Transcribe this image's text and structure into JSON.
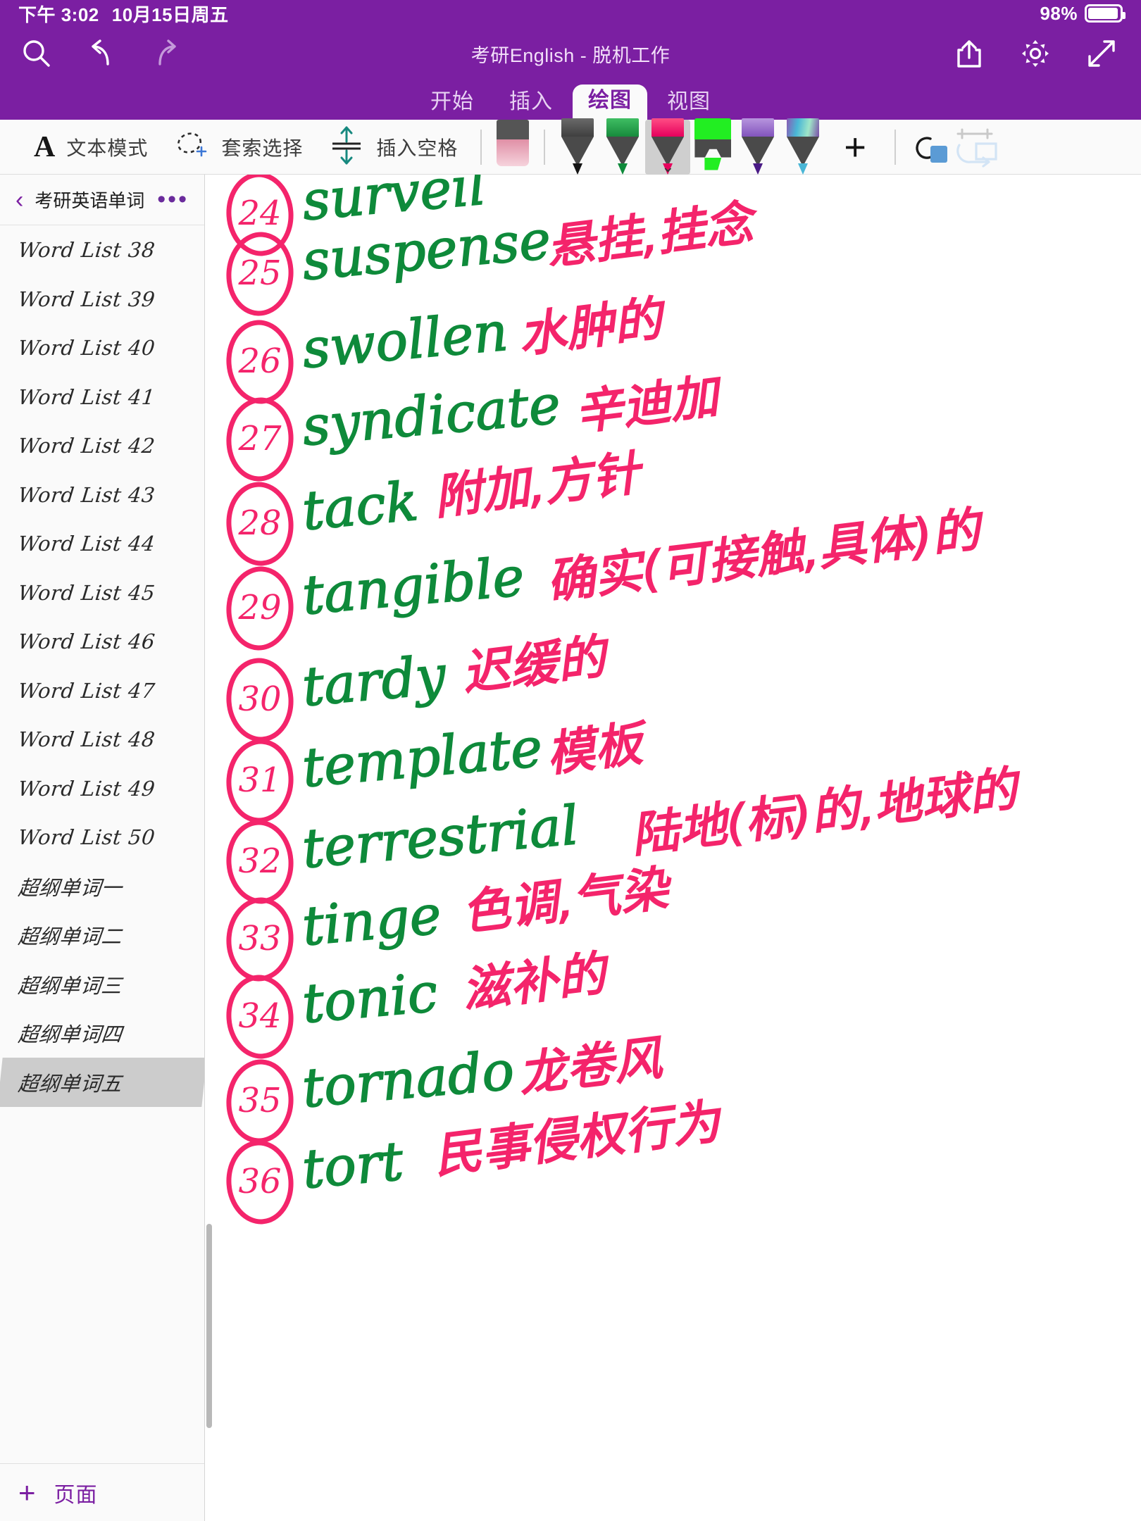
{
  "statusbar": {
    "time": "下午 3:02",
    "date": "10月15日周五",
    "battery_percent": "98%"
  },
  "header": {
    "doc_title": "考研English - 脱机工作",
    "icons": {
      "search": "search-icon",
      "undo": "undo-icon",
      "redo": "redo-icon",
      "share": "share-icon",
      "settings": "gear-icon",
      "expand": "expand-icon"
    },
    "tabs": [
      {
        "label": "开始",
        "active": false
      },
      {
        "label": "插入",
        "active": false
      },
      {
        "label": "绘图",
        "active": true
      },
      {
        "label": "视图",
        "active": false
      }
    ]
  },
  "toolbar": {
    "text_mode_glyph": "A",
    "text_mode_label": "文本模式",
    "lasso_label": "套索选择",
    "insert_space_label": "插入空格",
    "add_pen_glyph": "+",
    "pens": [
      {
        "name": "eraser",
        "cap": "#E79BAE",
        "body": "#4a4a4a",
        "tip": "#F2C2CE",
        "type": "eraser",
        "selected": false
      },
      {
        "name": "pen-black",
        "cap": "#555555",
        "body": "#4a4a4a",
        "tip": "#151515",
        "type": "pen",
        "selected": false
      },
      {
        "name": "pen-green",
        "cap": "#2EA14E",
        "body": "#4a4a4a",
        "tip": "#0E8A3A",
        "type": "pen",
        "selected": false
      },
      {
        "name": "pen-pink",
        "cap": "#F4246B",
        "body": "#4a4a4a",
        "tip": "#E6005C",
        "type": "pen",
        "selected": true
      },
      {
        "name": "highlighter-green",
        "cap": "#22EE22",
        "body": "#4a4a4a",
        "tip": "#22EE22",
        "type": "highlighter",
        "selected": false
      },
      {
        "name": "pen-purple",
        "cap": "#9B72CF",
        "body": "#4a4a4a",
        "tip": "#4A1B86",
        "type": "pen",
        "selected": false
      },
      {
        "name": "pen-galaxy",
        "cap": "#69C7D6",
        "body": "#4a4a4a",
        "tip": "#3EA8BE",
        "type": "pen",
        "selected": false
      }
    ],
    "ruler_icon": "ruler-icon",
    "convert_icon": "ink-to-shape-icon"
  },
  "sidebar": {
    "back_icon": "chevron-left-icon",
    "notebook_title": "考研英语单词...",
    "more_icon": "more-dots-icon",
    "items": [
      {
        "label": "Word List 38",
        "selected": false
      },
      {
        "label": "Word List 39",
        "selected": false
      },
      {
        "label": "Word List 40",
        "selected": false
      },
      {
        "label": "Word List 41",
        "selected": false
      },
      {
        "label": "Word List 42",
        "selected": false
      },
      {
        "label": "Word List 43",
        "selected": false
      },
      {
        "label": "Word List 44",
        "selected": false
      },
      {
        "label": "Word List 45",
        "selected": false
      },
      {
        "label": "Word List 46",
        "selected": false
      },
      {
        "label": "Word List 47",
        "selected": false
      },
      {
        "label": "Word List 48",
        "selected": false
      },
      {
        "label": "Word List 49",
        "selected": false
      },
      {
        "label": "Word List 50",
        "selected": false
      },
      {
        "label": "超纲单词一",
        "selected": false
      },
      {
        "label": "超纲单词二",
        "selected": false
      },
      {
        "label": "超纲单词三",
        "selected": false
      },
      {
        "label": "超纲单词四",
        "selected": false
      },
      {
        "label": "超纲单词五",
        "selected": true
      }
    ],
    "add_page_glyph": "+",
    "add_page_label": "页面"
  },
  "note": {
    "ink_colors": {
      "english": "#0E8A3A",
      "chinese": "#F4246B",
      "number": "#F4246B"
    },
    "entries": [
      {
        "num": "24",
        "word": "surveil",
        "cn": "",
        "partial_top": true
      },
      {
        "num": "25",
        "word": "suspense",
        "cn": "悬挂,挂念"
      },
      {
        "num": "26",
        "word": "swollen",
        "cn": "水肿的"
      },
      {
        "num": "27",
        "word": "syndicate",
        "cn": "辛迪加"
      },
      {
        "num": "28",
        "word": "tack",
        "cn": "附加,方针"
      },
      {
        "num": "29",
        "word": "tangible",
        "cn": "确实(可接触,具体)的"
      },
      {
        "num": "30",
        "word": "tardy",
        "cn": "迟缓的"
      },
      {
        "num": "31",
        "word": "template",
        "cn": "模板"
      },
      {
        "num": "32",
        "word": "terrestrial",
        "cn": "陆地(标)的,地球的"
      },
      {
        "num": "33",
        "word": "tinge",
        "cn": "色调,气染"
      },
      {
        "num": "34",
        "word": "tonic",
        "cn": "滋补的"
      },
      {
        "num": "35",
        "word": "tornado",
        "cn": "龙卷风"
      },
      {
        "num": "36",
        "word": "tort",
        "cn": "民事侵权行为"
      }
    ]
  }
}
